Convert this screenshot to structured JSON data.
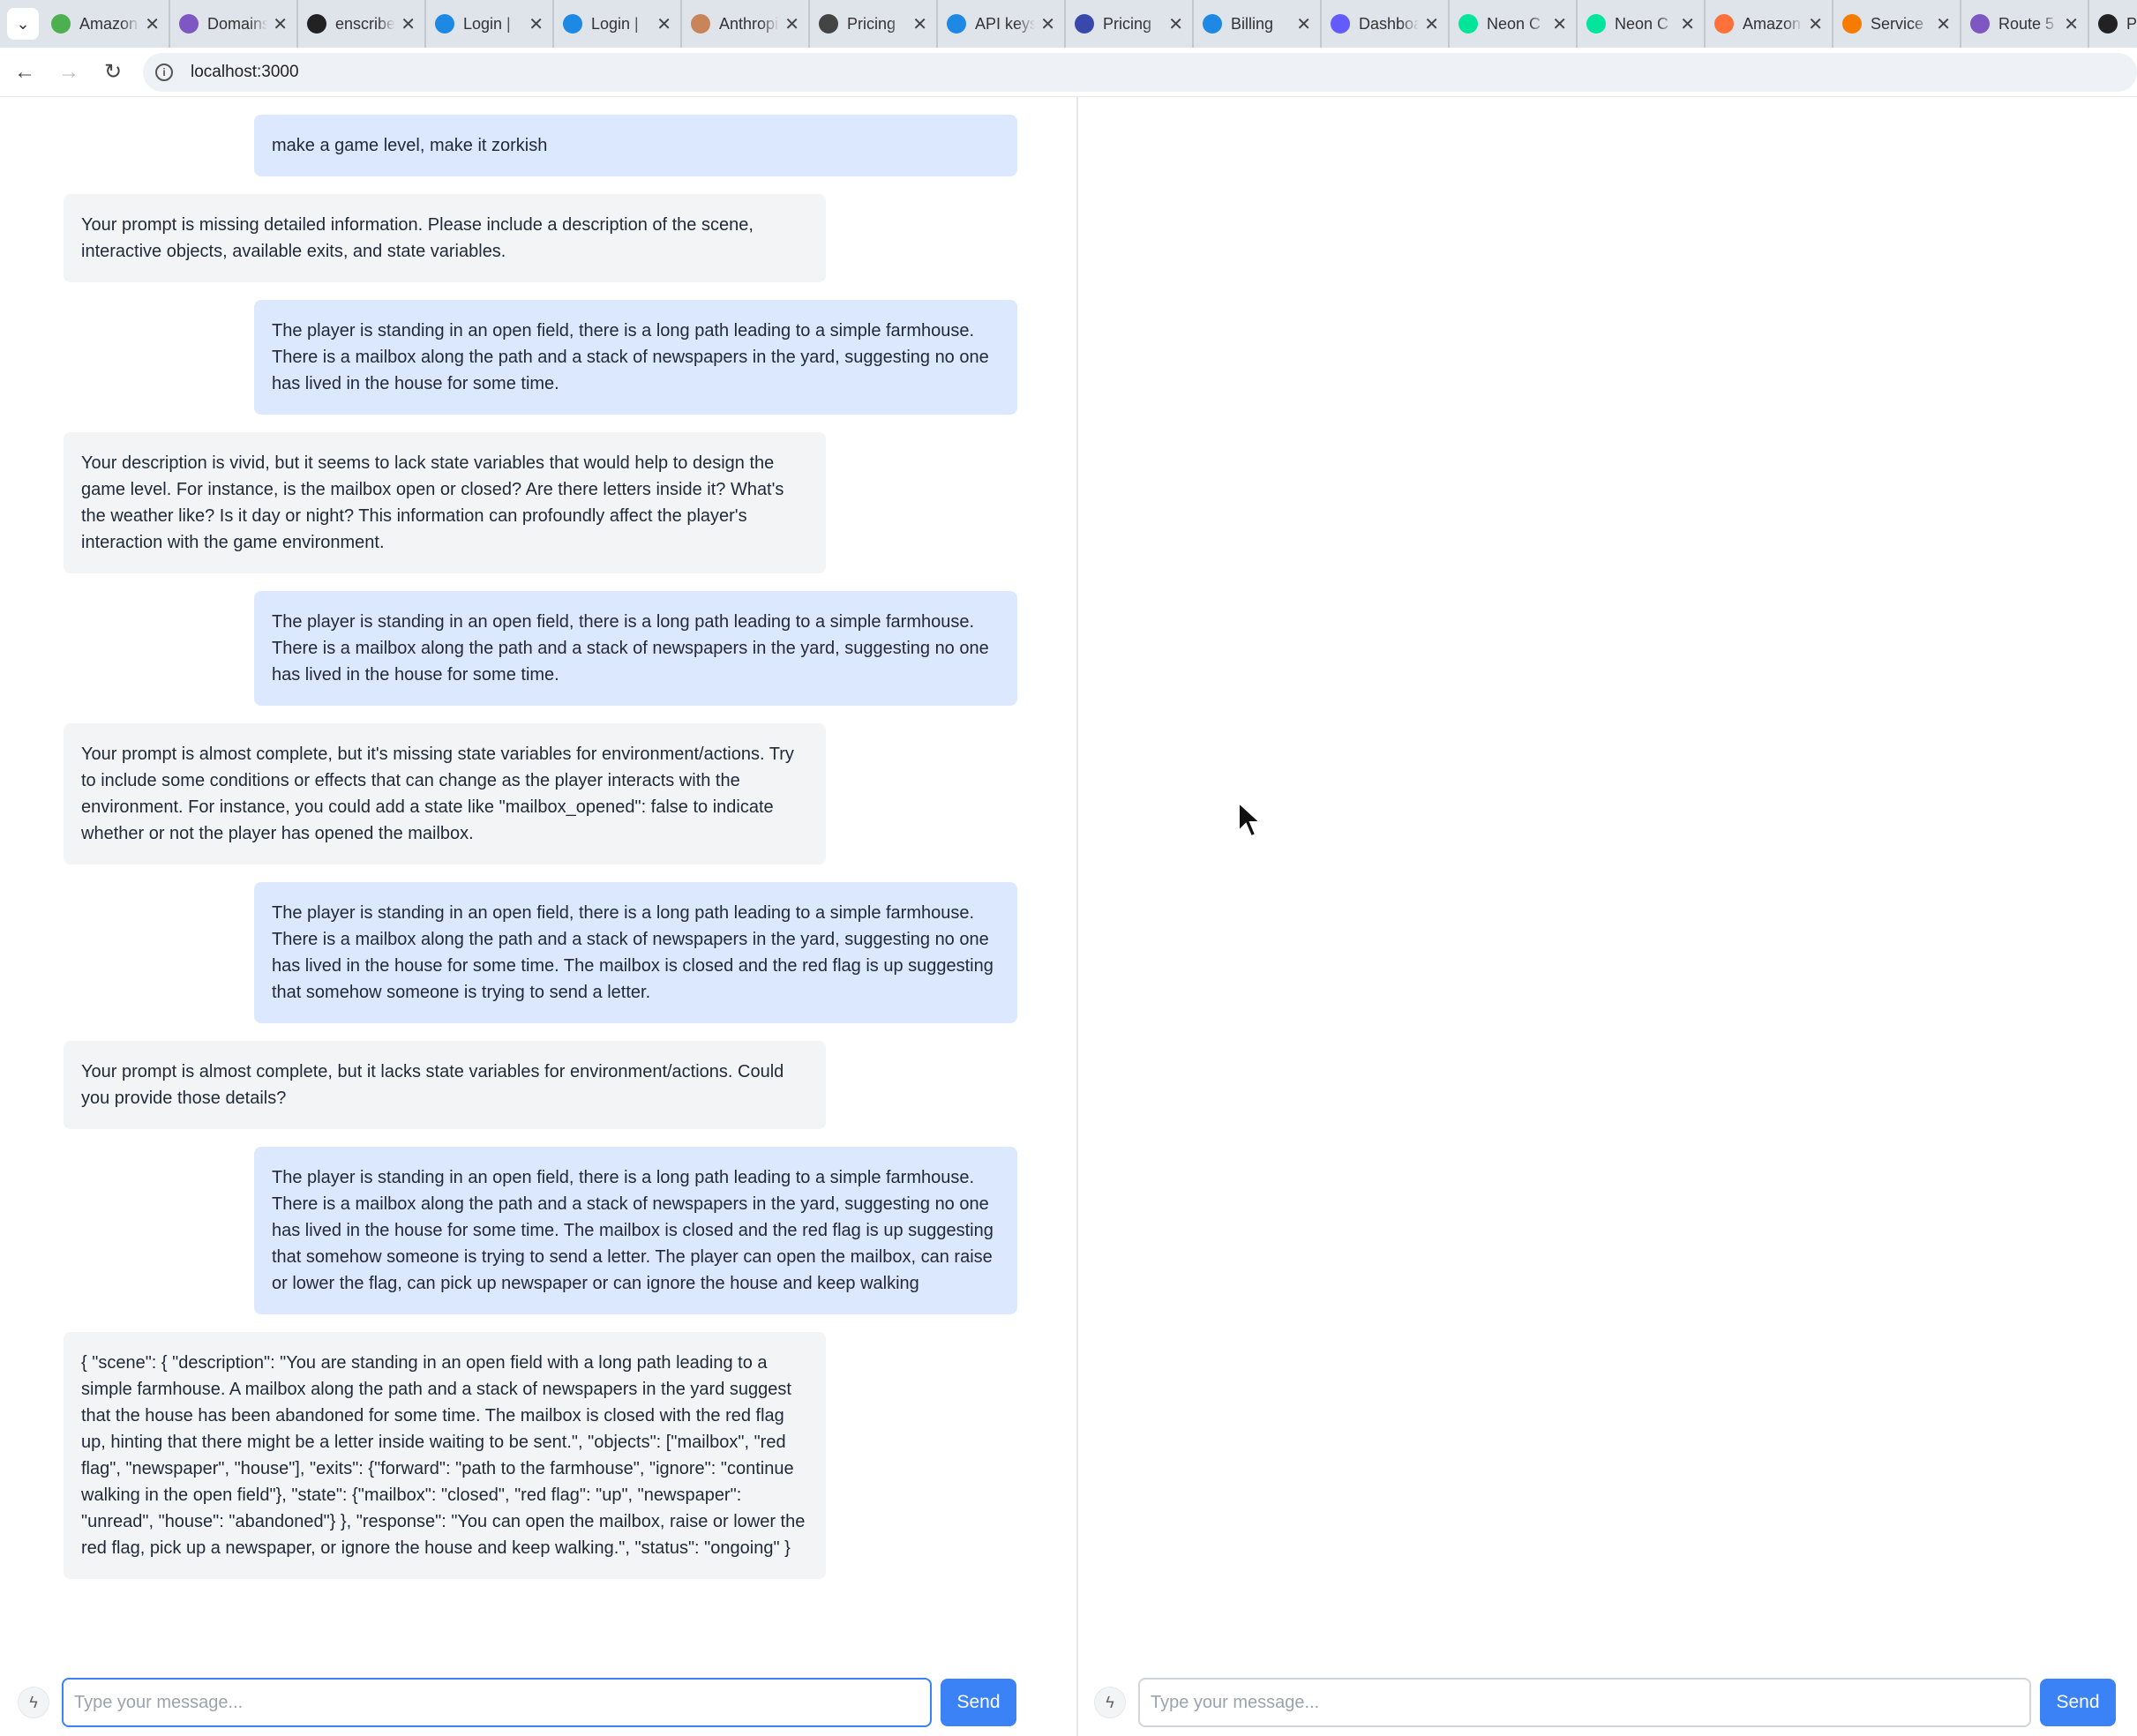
{
  "browser": {
    "tabs": [
      {
        "label": "Amazon",
        "icon": "gmail-icon",
        "color": "#4caf50"
      },
      {
        "label": "Domains",
        "icon": "porkbun-icon",
        "color": "#7e57c2"
      },
      {
        "label": "enscribe",
        "icon": "github-icon",
        "color": "#222222"
      },
      {
        "label": "Login |",
        "icon": "auth0-icon",
        "color": "#1e88e5"
      },
      {
        "label": "Login |",
        "icon": "auth0-icon",
        "color": "#1e88e5"
      },
      {
        "label": "Anthropic",
        "icon": "anthropic-icon",
        "color": "#c8855a"
      },
      {
        "label": "Pricing",
        "icon": "openai-icon",
        "color": "#444444"
      },
      {
        "label": "API keys",
        "icon": "globe-icon",
        "color": "#1e88e5"
      },
      {
        "label": "Pricing",
        "icon": "openai-icon",
        "color": "#3949ab"
      },
      {
        "label": "Billing",
        "icon": "openai-icon",
        "color": "#1e88e5"
      },
      {
        "label": "Dashboard",
        "icon": "stripe-icon",
        "color": "#635bff"
      },
      {
        "label": "Neon C",
        "icon": "neon-icon",
        "color": "#00e599"
      },
      {
        "label": "Neon C",
        "icon": "neon-icon",
        "color": "#00e599"
      },
      {
        "label": "Amazon",
        "icon": "firefox-icon",
        "color": "#ff7139"
      },
      {
        "label": "Service",
        "icon": "aws-icon",
        "color": "#f57c00"
      },
      {
        "label": "Route 5",
        "icon": "route53-icon",
        "color": "#7e57c2"
      },
      {
        "label": "P",
        "icon": "openai-icon",
        "color": "#222222"
      }
    ],
    "close_glyph": "✕",
    "url": "localhost:3000"
  },
  "left_chat": {
    "messages": [
      {
        "role": "user",
        "text": "make a game level, make it zorkish"
      },
      {
        "role": "assistant",
        "text": "Your prompt is missing detailed information. Please include a description of the scene, interactive objects, available exits, and state variables."
      },
      {
        "role": "user",
        "text": "The player is standing in an open field, there is a long path leading to a simple farmhouse. There is a mailbox along the path and a stack of newspapers in the yard, suggesting no one has lived in the house for some time."
      },
      {
        "role": "assistant",
        "text": "Your description is vivid, but it seems to lack state variables that would help to design the game level. For instance, is the mailbox open or closed? Are there letters inside it? What's the weather like? Is it day or night? This information can profoundly affect the player's interaction with the game environment."
      },
      {
        "role": "user",
        "text": "The player is standing in an open field, there is a long path leading to a simple farmhouse. There is a mailbox along the path and a stack of newspapers in the yard, suggesting no one has lived in the house for some time."
      },
      {
        "role": "assistant",
        "text": "Your prompt is almost complete, but it's missing state variables for environment/actions. Try to include some conditions or effects that can change as the player interacts with the environment. For instance, you could add a state like \"mailbox_opened\": false to indicate whether or not the player has opened the mailbox."
      },
      {
        "role": "user",
        "text": "The player is standing in an open field, there is a long path leading to a simple farmhouse. There is a mailbox along the path and a stack of newspapers in the yard, suggesting no one has lived in the house for some time. The mailbox is closed and the red flag is up suggesting that somehow someone is trying to send a letter."
      },
      {
        "role": "assistant",
        "text": "Your prompt is almost complete, but it lacks state variables for environment/actions. Could you provide those details?"
      },
      {
        "role": "user",
        "text": "The player is standing in an open field, there is a long path leading to a simple farmhouse. There is a mailbox along the path and a stack of newspapers in the yard, suggesting no one has lived in the house for some time. The mailbox is closed and the red flag is up suggesting that somehow someone is trying to send a letter. The player can open the mailbox, can raise or lower the flag, can pick up newspaper or can ignore the house and keep walking"
      },
      {
        "role": "assistant",
        "text": "{ \"scene\": { \"description\": \"You are standing in an open field with a long path leading to a simple farmhouse. A mailbox along the path and a stack of newspapers in the yard suggest that the house has been abandoned for some time. The mailbox is closed with the red flag up, hinting that there might be a letter inside waiting to be sent.\", \"objects\": [\"mailbox\", \"red flag\", \"newspaper\", \"house\"], \"exits\": {\"forward\": \"path to the farmhouse\", \"ignore\": \"continue walking in the open field\"}, \"state\": {\"mailbox\": \"closed\", \"red flag\": \"up\", \"newspaper\": \"unread\", \"house\": \"abandoned\"} }, \"response\": \"You can open the mailbox, raise or lower the red flag, pick up a newspaper, or ignore the house and keep walking.\", \"status\": \"ongoing\" }"
      }
    ],
    "input_placeholder": "Type your message...",
    "send_label": "Send"
  },
  "right_chat": {
    "input_placeholder": "Type your message...",
    "send_label": "Send"
  },
  "colors": {
    "user_bubble": "#dbe8fd",
    "assistant_bubble": "#f3f4f6",
    "accent": "#3b82f6"
  }
}
